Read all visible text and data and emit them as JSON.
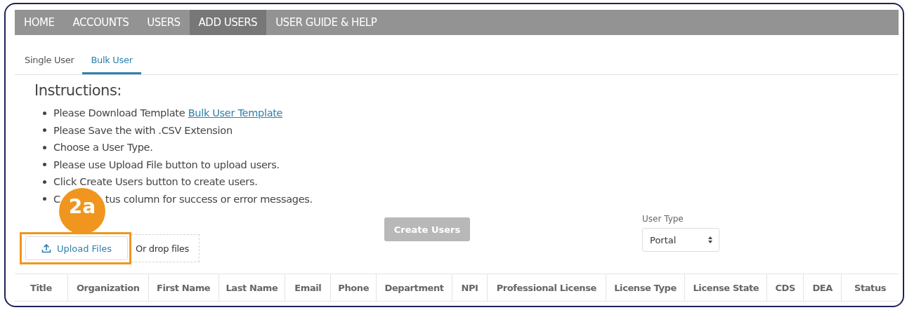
{
  "nav": [
    {
      "label": "HOME",
      "selected": false
    },
    {
      "label": "ACCOUNTS",
      "selected": false
    },
    {
      "label": "USERS",
      "selected": false
    },
    {
      "label": "ADD USERS",
      "selected": true
    },
    {
      "label": "USER GUIDE & HELP",
      "selected": false
    }
  ],
  "tabs": [
    {
      "label": "Single User",
      "selected": false
    },
    {
      "label": "Bulk User",
      "selected": true
    }
  ],
  "instructions": {
    "heading": "Instructions:",
    "items": [
      {
        "text": "Please Download Template ",
        "link": "Bulk User Template"
      },
      {
        "text": "Please Save the with .CSV Extension"
      },
      {
        "text": "Choose a User Type."
      },
      {
        "text": "Please use Upload File button to upload users."
      },
      {
        "text": "Click Create Users button to create users."
      },
      {
        "text": "C",
        "rest": "tus column for success or error messages."
      }
    ]
  },
  "annotation": {
    "badge": "2a"
  },
  "upload": {
    "button": "Upload Files",
    "drop_hint": "Or drop files"
  },
  "create_button": {
    "label": "Create Users",
    "disabled": true
  },
  "user_type": {
    "label": "User Type",
    "value": "Portal"
  },
  "table": {
    "columns": [
      "Title",
      "Organization",
      "First Name",
      "Last Name",
      "Email",
      "Phone",
      "Department",
      "NPI",
      "Professional License",
      "License Type",
      "License State",
      "CDS",
      "DEA",
      "Status"
    ]
  }
}
